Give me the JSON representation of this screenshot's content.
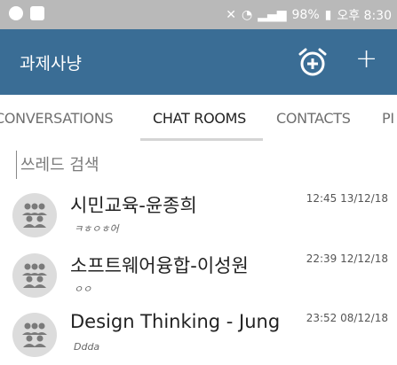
{
  "status_bar": {
    "battery": "98%",
    "time": "오후 8:30",
    "icons": [
      "messenger-icon",
      "image-icon",
      "mute-icon",
      "wifi-icon",
      "signal-icon",
      "battery-icon"
    ]
  },
  "app_bar": {
    "title": "과제사냥",
    "actions": [
      "alarm-add-icon",
      "add-icon"
    ],
    "add_symbol": "+"
  },
  "tabs": [
    {
      "label": "CONVERSATIONS"
    },
    {
      "label": "CHAT ROOMS",
      "active": true
    },
    {
      "label": "CONTACTS"
    },
    {
      "label": "PI"
    }
  ],
  "search": {
    "placeholder": "쓰레드 검색"
  },
  "rooms": [
    {
      "name": "시민교육-윤종희",
      "last_message": "ㅋㅎㅇㅎ어",
      "time": "12:45 13/12/18"
    },
    {
      "name": "소프트웨어융합-이성원",
      "last_message": "ㅇㅇ",
      "time": "22:39 12/12/18"
    },
    {
      "name": "Design Thinking - Jung",
      "last_message": "Ddda",
      "time": "23:52 08/12/18"
    }
  ],
  "colors": {
    "app_bar": "#3a6d95",
    "status_bar": "#b9b9b9",
    "avatar_bg": "#dcdcdc",
    "avatar_fg": "#7a7a7a"
  }
}
